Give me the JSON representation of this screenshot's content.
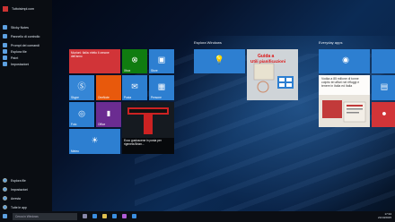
{
  "start_menu": {
    "user": "Tuttoisimpl.com",
    "items": [
      {
        "label": "Sticky Notes",
        "icon": "note-icon"
      },
      {
        "label": "Pannello di controllo",
        "icon": "control-panel-icon"
      },
      {
        "label": "Prompt dei comandi",
        "icon": "cmd-icon"
      },
      {
        "label": "Esplora file",
        "icon": "folder-icon"
      },
      {
        "label": "Paint",
        "icon": "paint-icon"
      },
      {
        "label": "Impostazioni",
        "icon": "gear-icon"
      }
    ],
    "bottom": [
      {
        "label": "Esplora file",
        "icon": "folder-icon"
      },
      {
        "label": "Impostazioni",
        "icon": "gear-icon"
      },
      {
        "label": "Arresta",
        "icon": "power-icon"
      },
      {
        "label": "Tutte le app",
        "icon": "apps-icon"
      }
    ]
  },
  "groups": {
    "g2": "Esplora Windows",
    "g3": "Everyday apps"
  },
  "tiles": {
    "mail_news": "Mozioni: Italia: eletto il cenone dell'anno",
    "xbox": "Xbox",
    "store": "Store",
    "skype": "Skype",
    "onenote": "OneNote",
    "mail": "Posta",
    "people": "Persone",
    "weather": "Meteo",
    "photos": "Foto",
    "office": "Office",
    "t_article": "Ecco gustoscene in posta per rigeneta Brian...",
    "guida_title": "Guida a",
    "guida_sub": "Utili pianificazioni",
    "news_article": "Vodka a 85 milione di tonne colpito tel affari nel riffuggi e tenere in Italia ed Italia"
  },
  "taskbar": {
    "search_placeholder": "Cerca in Windows",
    "time": "17:34",
    "date": "21/10/2015"
  },
  "colors": {
    "accent": "#2d7fd1",
    "menu_bg": "#0a0d12",
    "tile_red": "#d13438",
    "tile_green": "#107c10"
  }
}
